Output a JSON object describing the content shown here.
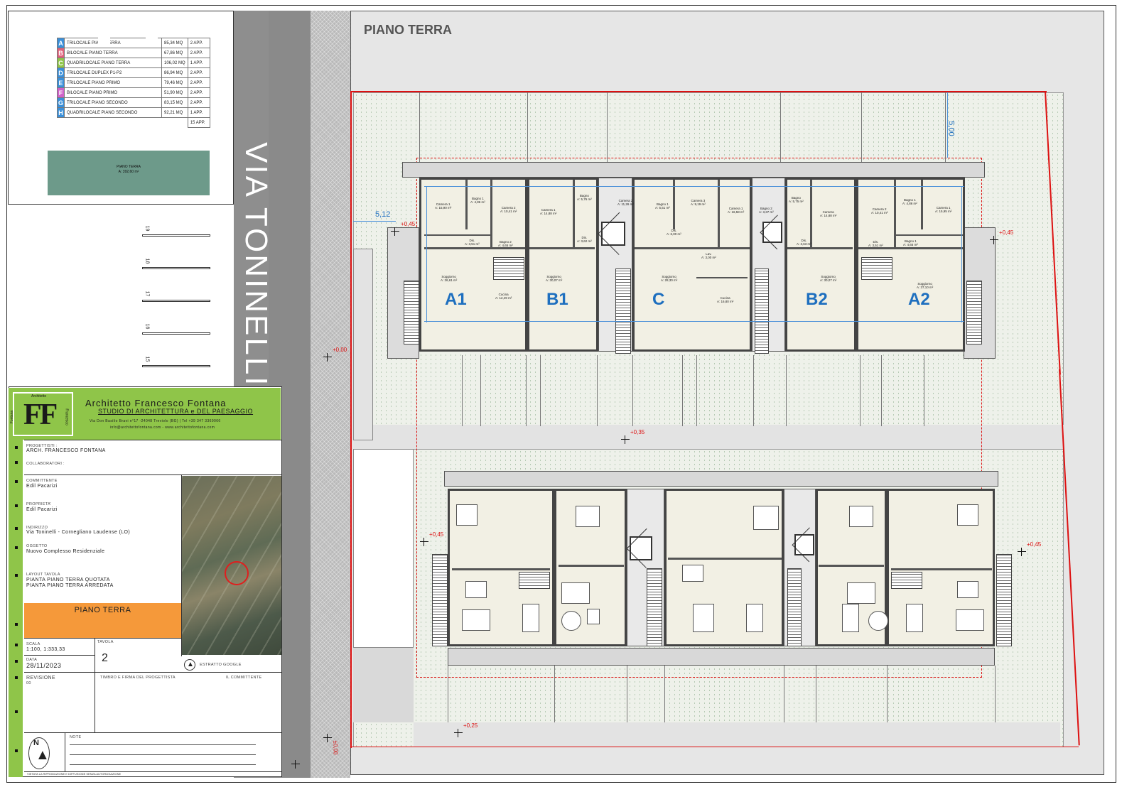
{
  "legend": {
    "rows": [
      {
        "letter": "A",
        "name": "TRILOCALE PIANO TERRA",
        "area": "85,34 MQ",
        "count": "2 APP.",
        "color": "#3a8fd9"
      },
      {
        "letter": "B",
        "name": "BILOCALE PIANO TERRA",
        "area": "67,86 MQ",
        "count": "2 APP.",
        "color": "#e0607a"
      },
      {
        "letter": "C",
        "name": "QUADRILOCALE PIANO TERRA",
        "area": "106,02 MQ",
        "count": "1 APP.",
        "color": "#8fc549"
      },
      {
        "letter": "D",
        "name": "TRILOCALE DUPLEX P1-P2",
        "area": "86,94 MQ",
        "count": "2 APP.",
        "color": "#3a8fd9"
      },
      {
        "letter": "E",
        "name": "TRILOCALE PIANO PRIMO",
        "area": "79,46 MQ",
        "count": "2 APP.",
        "color": "#3a8fd9"
      },
      {
        "letter": "F",
        "name": "BILOCALE PIANO PRIMO",
        "area": "51,90 MQ",
        "count": "2 APP.",
        "color": "#d062c9"
      },
      {
        "letter": "G",
        "name": "TRILOCALE PIANO SECONDO",
        "area": "83,15 MQ",
        "count": "2 APP.",
        "color": "#3a8fd9"
      },
      {
        "letter": "H",
        "name": "QUADRILOCALE PIANO SECONDO",
        "area": "92,21 MQ",
        "count": "1 APP.",
        "color": "#3a8fd9"
      }
    ],
    "total": "15 APP.",
    "mini_plan_title": "PIANO TERRA",
    "mini_plan_area": "A: 392,60 m²"
  },
  "street": {
    "name": "VIA TONINELLI",
    "parking_numbers": [
      "19",
      "18",
      "17",
      "16",
      "15"
    ]
  },
  "plan": {
    "title": "PIANO TERRA",
    "units": [
      "A1",
      "B1",
      "C",
      "B2",
      "A2"
    ],
    "levels": [
      "+0,45",
      "+0,45",
      "+0,00",
      "+0,35",
      "+0,45",
      "+0,45",
      "+0,25",
      "±0,00"
    ],
    "dims": [
      "5,12",
      "5,00"
    ],
    "rooms": [
      {
        "name": "Camera 1",
        "area": "A: 15,90 m²"
      },
      {
        "name": "Bagno 1",
        "area": "A: 4,86 m²"
      },
      {
        "name": "Camera 2",
        "area": "A: 10,41 m²"
      },
      {
        "name": "Dis.",
        "area": "A: 3,51 m²"
      },
      {
        "name": "Bagno 2",
        "area": "A: 4,65 m²"
      },
      {
        "name": "Soggiorno",
        "area": "A: 26,61 m²"
      },
      {
        "name": "Cucina",
        "area": "A: 12,49 m²"
      },
      {
        "name": "Camera 1",
        "area": "A: 14,88 m²"
      },
      {
        "name": "Bagno",
        "area": "A: 5,76 m²"
      },
      {
        "name": "Dis.",
        "area": "A: 3,62 m²"
      },
      {
        "name": "Soggiorno",
        "area": "A: 30,07 m²"
      },
      {
        "name": "Camera 2",
        "area": "A: 11,26 m²"
      },
      {
        "name": "Bagno 1",
        "area": "A: 5,51 m²"
      },
      {
        "name": "Camera 3",
        "area": "A: 9,19 m²"
      },
      {
        "name": "Camera 1",
        "area": "A: 16,58 m²"
      },
      {
        "name": "Bagno 2",
        "area": "A: 3,37 m²"
      },
      {
        "name": "Dis.",
        "area": "A: 6,00 m²"
      },
      {
        "name": "Lav.",
        "area": "A: 3,00 m²"
      },
      {
        "name": "Soggiorno",
        "area": "A: 28,30 m²"
      },
      {
        "name": "Cucina",
        "area": "A: 16,80 m²"
      },
      {
        "name": "Bagno",
        "area": "A: 5,75 m²"
      },
      {
        "name": "Camera",
        "area": "A: 14,88 m²"
      },
      {
        "name": "Dis.",
        "area": "A: 3,63 m²"
      },
      {
        "name": "Soggiorno",
        "area": "A: 30,07 m²"
      },
      {
        "name": "Camera 2",
        "area": "A: 10,41 m²"
      },
      {
        "name": "Bagno 1",
        "area": "A: 4,86 m²"
      },
      {
        "name": "Camera 1",
        "area": "A: 15,95 m²"
      },
      {
        "name": "Bagno 1",
        "area": "A: 4,65 m²"
      },
      {
        "name": "Dis.",
        "area": "A: 3,51 m²"
      },
      {
        "name": "Soggiorno",
        "area": "A: 37,10 m²"
      }
    ]
  },
  "title_block": {
    "logo_letters": "FF",
    "logo_top": "Architetto",
    "logo_left": "Fontana",
    "logo_right": "Francesco",
    "architect": "Architetto Francesco Fontana",
    "studio": "STUDIO DI ARCHITETTURA e DEL PAESAGGIO",
    "address": "Via Don Basilio Bravi n°17 -24048 Treviolo (BG) | Tel +39 347 3369066",
    "contacts": "info@architettofontana.com - www.architettofontana.com",
    "fields": [
      {
        "label": "PROGETTISTI :",
        "value": "ARCH. FRANCESCO FONTANA"
      },
      {
        "label": "COLLABORATORI :",
        "value": ""
      },
      {
        "label": "COMMITTENTE",
        "value": "Edil Pacarizi"
      },
      {
        "label": "PROPRIETA'",
        "value": "Edil Pacarizi"
      },
      {
        "label": "INDIRIZZO",
        "value": "Via Toninelli - Cornegliano Laudense (LO)"
      },
      {
        "label": "OGGETTO",
        "value": "Nuovo Complesso Residenziale"
      },
      {
        "label": "LAYOUT TAVOLA",
        "value": "PIANTA PIANO TERRA QUOTATA"
      },
      {
        "label": "",
        "value": "PIANTA PIANO TERRA ARREDATA"
      }
    ],
    "sheet_title": "PIANO TERRA",
    "scale_label": "SCALA",
    "scale_value": "1:100, 1:333,33",
    "tavola_label": "TAVOLA",
    "tavola_value": "2",
    "date_label": "DATA",
    "date_value": "28/11/2023",
    "revision_label": "REVISIONE",
    "revision_value": "00",
    "stamp_label": "TIMBRO E FIRMA DEL PROGETTISTA",
    "client_label": "IL COMMITTENTE",
    "google_label": "ESTRATTO GOOGLE",
    "notes_label": "NOTE",
    "footer": "VIETATA LA RIPRODUZIONE E DIFFUSIONE SENZA AUTORIZZAZIONE"
  }
}
